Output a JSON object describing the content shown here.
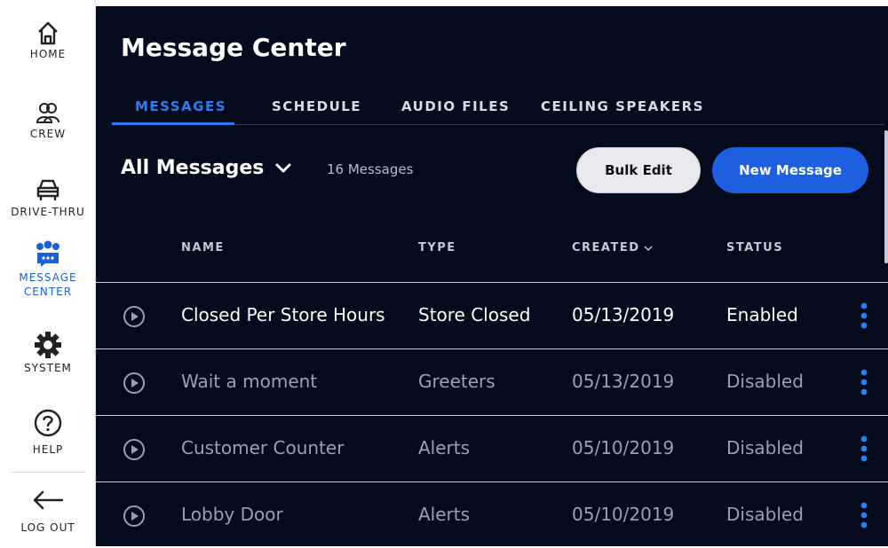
{
  "sidebar": {
    "items": [
      {
        "label": "HOME",
        "icon": "home-icon"
      },
      {
        "label": "CREW",
        "icon": "crew-icon"
      },
      {
        "label": "DRIVE-THRU",
        "icon": "car-icon"
      },
      {
        "label": "MESSAGE\nCENTER",
        "label_line1": "MESSAGE",
        "label_line2": "CENTER",
        "icon": "message-center-icon",
        "active": true
      },
      {
        "label": "SYSTEM",
        "icon": "gear-icon"
      },
      {
        "label": "HELP",
        "icon": "help-icon"
      },
      {
        "label": "LOG OUT",
        "icon": "logout-arrow-icon"
      }
    ]
  },
  "header": {
    "title": "Message Center"
  },
  "tabs": [
    {
      "label": "MESSAGES",
      "active": true
    },
    {
      "label": "SCHEDULE"
    },
    {
      "label": "AUDIO FILES"
    },
    {
      "label": "CEILING SPEAKERS"
    }
  ],
  "toolbar": {
    "filter_label": "All Messages",
    "count_label": "16 Messages",
    "bulk_edit_label": "Bulk Edit",
    "new_message_label": "New Message"
  },
  "table": {
    "columns": [
      "NAME",
      "TYPE",
      "CREATED",
      "STATUS"
    ],
    "sorted_column": "CREATED",
    "rows": [
      {
        "name": "Closed Per Store Hours",
        "type": "Store Closed",
        "created": "05/13/2019",
        "status": "Enabled"
      },
      {
        "name": "Wait a moment",
        "type": "Greeters",
        "created": "05/13/2019",
        "status": "Disabled"
      },
      {
        "name": "Customer Counter",
        "type": "Alerts",
        "created": "05/10/2019",
        "status": "Disabled"
      },
      {
        "name": "Lobby Door",
        "type": "Alerts",
        "created": "05/10/2019",
        "status": "Disabled"
      }
    ]
  },
  "colors": {
    "background": "#040b1c",
    "accent": "#2f7bf0",
    "primary_button": "#1e5fe0",
    "kebab": "#2f7bf0"
  }
}
